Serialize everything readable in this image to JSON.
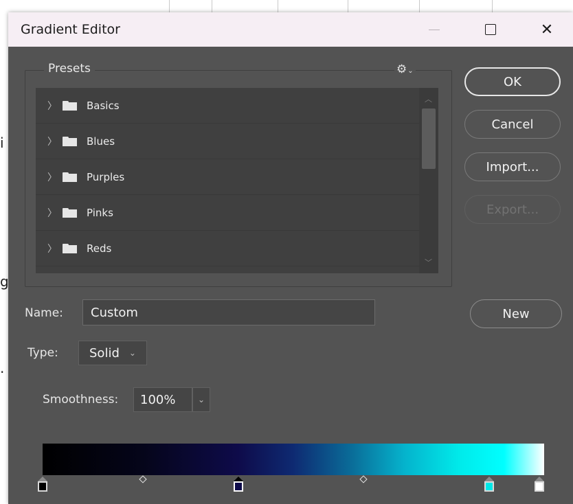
{
  "background": {
    "fragments": [
      "i",
      "g",
      "."
    ],
    "top_chevrons": [
      "⌄",
      "⌄",
      "⌄"
    ]
  },
  "window": {
    "title": "Gradient Editor",
    "minimize_icon": "minimize-icon",
    "maximize_icon": "maximize-icon",
    "close_label": "✕"
  },
  "presets": {
    "label": "Presets",
    "gear_icon": "⚙",
    "gear_caret": "⌄",
    "items": [
      {
        "label": "Basics"
      },
      {
        "label": "Blues"
      },
      {
        "label": "Purples"
      },
      {
        "label": "Pinks"
      },
      {
        "label": "Reds"
      }
    ],
    "scroll_up": "︿",
    "scroll_down": "﹀"
  },
  "buttons": {
    "ok": "OK",
    "cancel": "Cancel",
    "import": "Import...",
    "export": "Export...",
    "new": "New"
  },
  "form": {
    "name_label": "Name:",
    "name_value": "Custom",
    "type_label": "Type:",
    "type_value": "Solid",
    "smoothness_label": "Smoothness:",
    "smoothness_value": "100%",
    "dropdown_arrow": "⌄"
  },
  "gradient": {
    "stops": [
      {
        "color": "#000000",
        "location": 0,
        "selected": false
      },
      {
        "color": "#0e0b4a",
        "location": 39,
        "selected": true
      },
      {
        "color": "#00e8e8",
        "location": 89,
        "selected": false
      },
      {
        "color": "#ffffff",
        "location": 100,
        "selected": false
      }
    ],
    "midpoints": [
      20,
      64
    ]
  }
}
